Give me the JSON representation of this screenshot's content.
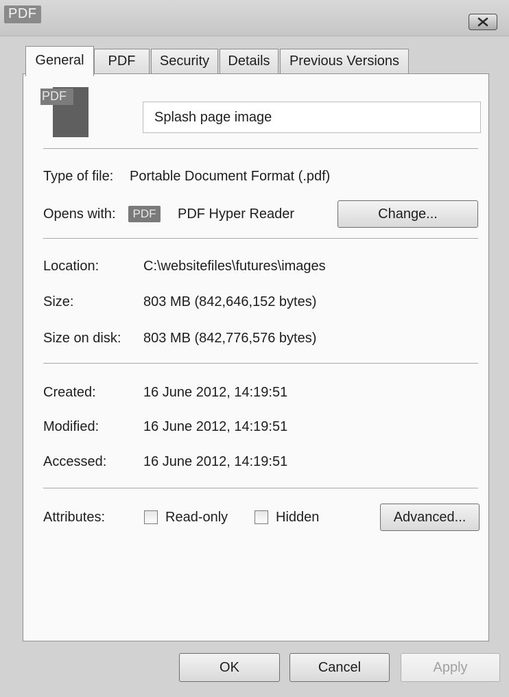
{
  "window": {
    "title": "PDF",
    "close_label": "close"
  },
  "tabs": [
    {
      "label": "General",
      "active": true
    },
    {
      "label": "PDF"
    },
    {
      "label": "Security"
    },
    {
      "label": "Details"
    },
    {
      "label": "Previous Versions"
    }
  ],
  "file": {
    "icon_text": "PDF",
    "name": "Splash page image"
  },
  "type_row": {
    "label": "Type of file:",
    "value": "Portable Document Format  (.pdf)"
  },
  "opens_row": {
    "label": "Opens with:",
    "app_icon_text": "PDF",
    "app_name": "PDF Hyper Reader",
    "change_label": "Change..."
  },
  "location": {
    "label": "Location:",
    "value": "C:\\websitefiles\\futures\\images"
  },
  "size": {
    "label": "Size:",
    "value": "803 MB (842,646,152 bytes)"
  },
  "size_on_disk": {
    "label": "Size on disk:",
    "value": "803 MB (842,776,576 bytes)"
  },
  "created": {
    "label": "Created:",
    "value": "16 June 2012, 14:19:51"
  },
  "modified": {
    "label": "Modified:",
    "value": "16 June 2012, 14:19:51"
  },
  "accessed": {
    "label": "Accessed:",
    "value": "16 June 2012, 14:19:51"
  },
  "attributes": {
    "label": "Attributes:",
    "readonly_label": "Read-only",
    "readonly_checked": false,
    "hidden_label": "Hidden",
    "hidden_checked": false,
    "advanced_label": "Advanced..."
  },
  "footer": {
    "ok_label": "OK",
    "cancel_label": "Cancel",
    "apply_label": "Apply"
  },
  "colors": {
    "title_bar": "#c8c8c8",
    "panel_bg": "#fafafa",
    "icon_dark": "#5f5f5f"
  }
}
